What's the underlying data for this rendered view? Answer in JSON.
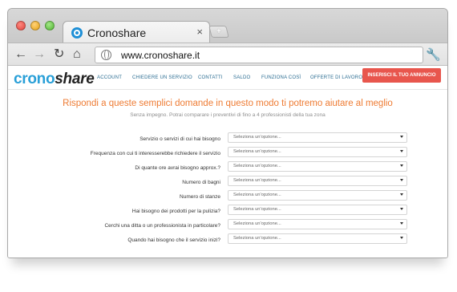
{
  "browser": {
    "tab_title": "Cronoshare",
    "tab_close": "×",
    "new_tab": "+",
    "url": "www.cronoshare.it"
  },
  "site": {
    "logo_part1": "crono",
    "logo_part2": "share",
    "menu": [
      "ACCOUNT",
      "CHIEDERE UN SERVIZIO",
      "CONTATTI",
      "SALDO",
      "FUNZIONA COSÌ",
      "OFFERTE DI LAVORO"
    ],
    "cta": "INSERISCI IL TUO ANNUNCIO"
  },
  "form": {
    "heading": "Rispondi a queste semplici domande in questo modo ti potremo aiutare al meglio",
    "subheading": "Senza impegno. Potrai comparare i preventivi di fino a 4 professionisti della tua zona",
    "questions": [
      {
        "label": "Servizio o servizi di cui hai bisogno",
        "value": "Seleziona un'opzione..."
      },
      {
        "label": "Frequenza con cui ti interesserebbe richiedere il servizio",
        "value": "Seleziona un'opzione..."
      },
      {
        "label": "Di quante ore avrai bisogno approx.?",
        "value": "Seleziona un'opzione..."
      },
      {
        "label": "Numero di bagni",
        "value": "Seleziona un'opzione..."
      },
      {
        "label": "Numero di stanze",
        "value": "Seleziona un'opzione..."
      },
      {
        "label": "Hai bisogno dei prodotti per la pulizia?",
        "value": "Seleziona un'opzione..."
      },
      {
        "label": "Cerchi una ditta o un professionista in particolare?",
        "value": "Seleziona un'opzione..."
      },
      {
        "label": "Quando hai bisogno che il servizio inizi?",
        "value": "Seleziona un'opzione..."
      }
    ]
  },
  "colors": {
    "brand_blue": "#2aa0d8",
    "heading_orange": "#ee7b33",
    "cta_red": "#e8564d"
  },
  "icons": [
    "back-arrow-icon",
    "forward-arrow-icon",
    "reload-icon",
    "home-icon",
    "globe-icon",
    "wrench-icon",
    "favicon-icon",
    "chevron-down-icon"
  ]
}
